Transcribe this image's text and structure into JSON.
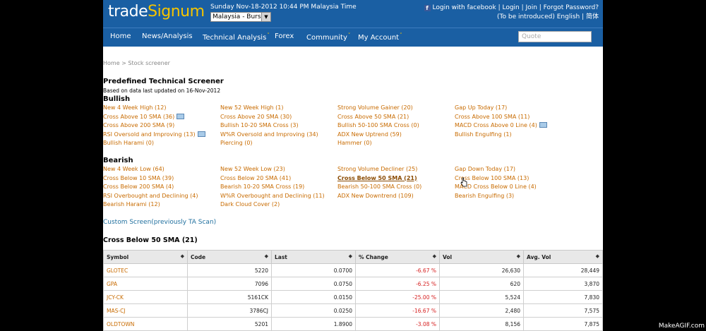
{
  "header": {
    "logo_part1": "trade",
    "logo_part2": "Signum",
    "datetime": "Sunday Nov-18-2012 10:44 PM Malaysia Time",
    "market_selected": "Malaysia - Bursa",
    "login_facebook": "Login with facebook",
    "sep1": " | ",
    "login": "Login",
    "sep2": " | ",
    "join": "Join",
    "sep3": " | ",
    "forgot": "Forgot Password?",
    "intro": "(To be introduced)",
    "lang_en": "English",
    "sep4": " | ",
    "lang_zh": "简体"
  },
  "nav": {
    "home": "Home",
    "news": "News/Analysis",
    "ta": "Technical Analysis",
    "forex": "Forex",
    "community": "Community",
    "account": "My Account",
    "quote_placeholder": "Quote"
  },
  "breadcrumb": "Home > Stock screener",
  "title": "Predefined Technical Screener",
  "subtitle": "Based on data last updated on 16-Nov-2012",
  "bullish": {
    "heading": "Bullish",
    "items": [
      [
        "New 4 Week High (12)",
        "New 52 Week High (1)",
        "Strong Volume Gainer (20)",
        "Gap Up Today (17)"
      ],
      [
        "Cross Above 10 SMA (36)",
        "Cross Above 20 SMA (30)",
        "Cross Above 50 SMA (21)",
        "Cross Above 100 SMA (11)"
      ],
      [
        "Cross Above 200 SMA (9)",
        "Bullish 10-20 SMA Cross (3)",
        "Bullish 50-100 SMA Cross (0)",
        "MACD Cross Above 0 Line (4)"
      ],
      [
        "RSI Oversold and Improving (13)",
        "W%R Oversold and Improving (34)",
        "ADX New Uptrend (59)",
        "Bullish Engulfing (1)"
      ],
      [
        "Bullish Harami (0)",
        "Piercing (0)",
        "Hammer (0)",
        ""
      ]
    ]
  },
  "bearish": {
    "heading": "Bearish",
    "items": [
      [
        "New 4 Week Low (64)",
        "New 52 Week Low (23)",
        "Strong Volume Decliner (25)",
        "Gap Down Today (17)"
      ],
      [
        "Cross Below 10 SMA (39)",
        "Cross Below 20 SMA (41)",
        "Cross Below 50 SMA (21)",
        "Cross Below 100 SMA (13)"
      ],
      [
        "Cross Below 200 SMA (4)",
        "Bearish 10-20 SMA Cross (19)",
        "Bearish 50-100 SMA Cross (0)",
        "MACD Cross Below 0 Line (4)"
      ],
      [
        "RSI Overbought and Declining (4)",
        "W%R Overbought and Declining (11)",
        "ADX New Downtrend (109)",
        "Bearish Engulfing (3)"
      ],
      [
        "Bearish Harami (12)",
        "Dark Cloud Cover (2)",
        "",
        ""
      ]
    ]
  },
  "custom_link": "Custom Screen(previously TA Scan)",
  "results_title": "Cross Below 50 SMA (21)",
  "table": {
    "headers": [
      "Symbol",
      "Code",
      "Last",
      "% Change",
      "Vol",
      "Avg. Vol"
    ],
    "rows": [
      [
        "GLOTEC",
        "5220",
        "0.0700",
        "-6.67 %",
        "26,630",
        "28,449"
      ],
      [
        "GPA",
        "7096",
        "0.0750",
        "-6.25 %",
        "620",
        "3,870"
      ],
      [
        "JCY-CK",
        "5161CK",
        "0.0150",
        "-25.00 %",
        "5,524",
        "7,830"
      ],
      [
        "MAS-CJ",
        "3786CJ",
        "0.0250",
        "-16.67 %",
        "2,480",
        "7,575"
      ],
      [
        "OLDTOWN",
        "5201",
        "1.8900",
        "-3.08 %",
        "8,156",
        "7,875"
      ]
    ]
  },
  "watermark": "MakeAGIF.com"
}
